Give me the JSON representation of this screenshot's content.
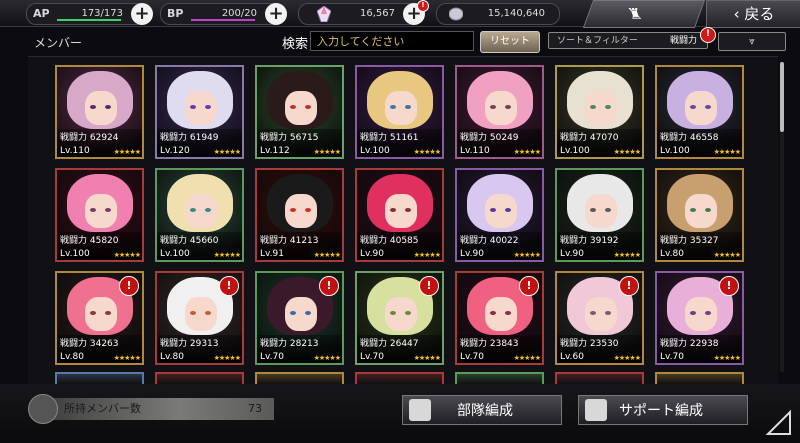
{
  "topbar": {
    "ap": {
      "label": "AP",
      "value": "173/173",
      "fraction": 1.0
    },
    "bp": {
      "label": "BP",
      "value": "200/20",
      "fraction": 1.0
    },
    "currency1": {
      "value": "16,567"
    },
    "currency2": {
      "value": "15,140,640"
    },
    "home_label": "ホーム",
    "back_label": "戻る"
  },
  "filter": {
    "members_label": "メンバー",
    "search_label": "検索",
    "search_placeholder": "入力してください",
    "reset_label": "リセット",
    "sort_label": "ソート＆フィルター",
    "sort_value": "戦闘力",
    "alert_mark": "!"
  },
  "cards": [
    {
      "power": "戦闘力 62924",
      "level": "Lv.110",
      "stars": "★★★★★",
      "hair": "#d8a8c8",
      "bg": "#5a2a4a",
      "frame": "#b08a3a",
      "eye": "#5a2a6a",
      "alert": false
    },
    {
      "power": "戦闘力 61949",
      "level": "Lv.120",
      "stars": "★★★★★",
      "hair": "#e0dcf0",
      "bg": "#3a2a5a",
      "frame": "#8a7aa8",
      "eye": "#6a3aaa",
      "alert": false
    },
    {
      "power": "戦闘力 56715",
      "level": "Lv.112",
      "stars": "★★★★★",
      "hair": "#2a1a1a",
      "bg": "#2a4a2a",
      "frame": "#6aa06a",
      "eye": "#c03030",
      "alert": false
    },
    {
      "power": "戦闘力 51161",
      "level": "Lv.100",
      "stars": "★★★★★",
      "hair": "#e8c880",
      "bg": "#3a1a4a",
      "frame": "#8a5aa8",
      "eye": "#3a7aaa",
      "alert": false
    },
    {
      "power": "戦闘力 50249",
      "level": "Lv.110",
      "stars": "★★★★★",
      "hair": "#f0a0c0",
      "bg": "#4a1a3a",
      "frame": "#a05a8a",
      "eye": "#7a3a5a",
      "alert": false
    },
    {
      "power": "戦闘力 47070",
      "level": "Lv.100",
      "stars": "★★★★★",
      "hair": "#e8e0d0",
      "bg": "#3a3a2a",
      "frame": "#b09a4a",
      "eye": "#4a8a5a",
      "alert": false
    },
    {
      "power": "戦闘力 46558",
      "level": "Lv.100",
      "stars": "★★★★★",
      "hair": "#c8b0e0",
      "bg": "#2a2a3a",
      "frame": "#b08a3a",
      "eye": "#6a4a9a",
      "alert": false
    },
    {
      "power": "戦闘力 45820",
      "level": "Lv.100",
      "stars": "★★★★★",
      "hair": "#f080b0",
      "bg": "#3a0a1a",
      "frame": "#a83a3a",
      "eye": "#7a3a6a",
      "alert": false
    },
    {
      "power": "戦闘力 45660",
      "level": "Lv.100",
      "stars": "★★★★★",
      "hair": "#f0e0b0",
      "bg": "#2a4a3a",
      "frame": "#5a9a5a",
      "eye": "#3a8a8a",
      "alert": false
    },
    {
      "power": "戦闘力 41213",
      "level": "Lv.91",
      "stars": "★★★★★",
      "hair": "#1a1a1a",
      "bg": "#3a0a0a",
      "frame": "#a83a3a",
      "eye": "#d03030",
      "alert": false
    },
    {
      "power": "戦闘力 40585",
      "level": "Lv.90",
      "stars": "★★★★★",
      "hair": "#e03060",
      "bg": "#2a0a1a",
      "frame": "#a83a3a",
      "eye": "#8a2a3a",
      "alert": false
    },
    {
      "power": "戦闘力 40022",
      "level": "Lv.90",
      "stars": "★★★★★",
      "hair": "#d8c8f0",
      "bg": "#2a1a3a",
      "frame": "#8a5aa8",
      "eye": "#5a3a9a",
      "alert": false
    },
    {
      "power": "戦闘力 39192",
      "level": "Lv.90",
      "stars": "★★★★★",
      "hair": "#e8e8e8",
      "bg": "#1a2a1a",
      "frame": "#5a9a5a",
      "eye": "#5a5a5a",
      "alert": false
    },
    {
      "power": "戦闘力 35327",
      "level": "Lv.80",
      "stars": "★★★★★",
      "hair": "#c8a070",
      "bg": "#3a2a1a",
      "frame": "#b08a3a",
      "eye": "#4a7a4a",
      "alert": false
    },
    {
      "power": "戦闘力 34263",
      "level": "Lv.80",
      "stars": "★★★★★",
      "hair": "#f07090",
      "bg": "#2a1a1a",
      "frame": "#b08a3a",
      "eye": "#8a3a3a",
      "alert": true
    },
    {
      "power": "戦闘力 29313",
      "level": "Lv.80",
      "stars": "★★★★★",
      "hair": "#f0f0f0",
      "bg": "#3a2a2a",
      "frame": "#a83a3a",
      "eye": "#c06030",
      "alert": true
    },
    {
      "power": "戦闘力 28213",
      "level": "Lv.70",
      "stars": "★★★★★",
      "hair": "#3a1a2a",
      "bg": "#1a3a2a",
      "frame": "#5a9a5a",
      "eye": "#3a6aaa",
      "alert": true
    },
    {
      "power": "戦闘力 26447",
      "level": "Lv.70",
      "stars": "★★★★★",
      "hair": "#d8e0a0",
      "bg": "#2a3a1a",
      "frame": "#6aa06a",
      "eye": "#6a8a3a",
      "alert": true
    },
    {
      "power": "戦闘力 23843",
      "level": "Lv.70",
      "stars": "★★★★★",
      "hair": "#f06080",
      "bg": "#2a0a1a",
      "frame": "#a83a3a",
      "eye": "#8a2a4a",
      "alert": true
    },
    {
      "power": "戦闘力 23530",
      "level": "Lv.60",
      "stars": "★★★★★",
      "hair": "#f0c8d8",
      "bg": "#2a2a2a",
      "frame": "#b08a3a",
      "eye": "#7a5a7a",
      "alert": true
    },
    {
      "power": "戦闘力 22938",
      "level": "Lv.70",
      "stars": "★★★★★",
      "hair": "#e8b0d8",
      "bg": "#3a1a3a",
      "frame": "#8a5aa8",
      "eye": "#7a3a8a",
      "alert": true
    }
  ],
  "partial_frames": [
    "#5a7aa8",
    "#a83a3a",
    "#b08a3a",
    "#a83a3a",
    "#5a9a5a",
    "#a83a3a",
    "#b08a3a"
  ],
  "bottom": {
    "owned_label": "所持メンバー数",
    "owned_count": "73",
    "party_label": "部隊編成",
    "support_label": "サポート編成"
  }
}
